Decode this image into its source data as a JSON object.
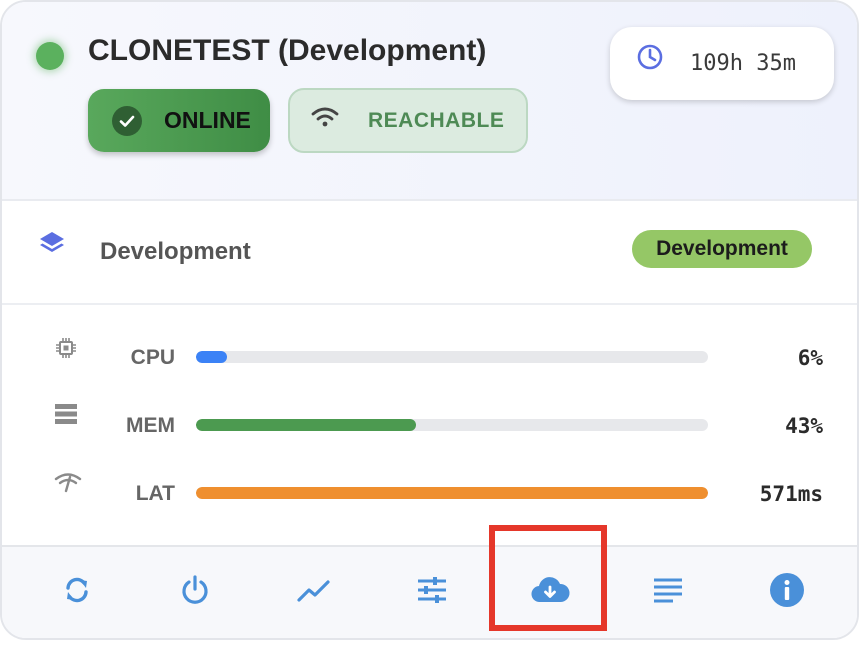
{
  "device": {
    "title": "CLONETEST (Development)",
    "status_color": "#5bb15e",
    "online_label": "ONLINE",
    "reachable_label": "REACHABLE",
    "uptime": "109h 35m"
  },
  "environment": {
    "label": "Development",
    "tag": "Development",
    "tag_color": "#95c766"
  },
  "metrics": [
    {
      "key": "cpu",
      "label": "CPU",
      "value": "6%",
      "fraction": 0.06,
      "icon": "cpu-chip-icon",
      "color": "#3b82f6"
    },
    {
      "key": "mem",
      "label": "MEM",
      "value": "43%",
      "fraction": 0.43,
      "icon": "memory-stack-icon",
      "color": "#4c9a50"
    },
    {
      "key": "lat",
      "label": "LAT",
      "value": "571ms",
      "fraction": 1.0,
      "icon": "weak-signal-icon",
      "color": "#ef8f2f"
    }
  ],
  "toolbar": {
    "icon_color": "#4a90d9",
    "items": [
      "refresh-icon",
      "power-icon",
      "trend-chart-icon",
      "sliders-icon",
      "cloud-download-icon",
      "list-lines-icon",
      "info-icon"
    ]
  },
  "highlight_color": "#e5372a"
}
